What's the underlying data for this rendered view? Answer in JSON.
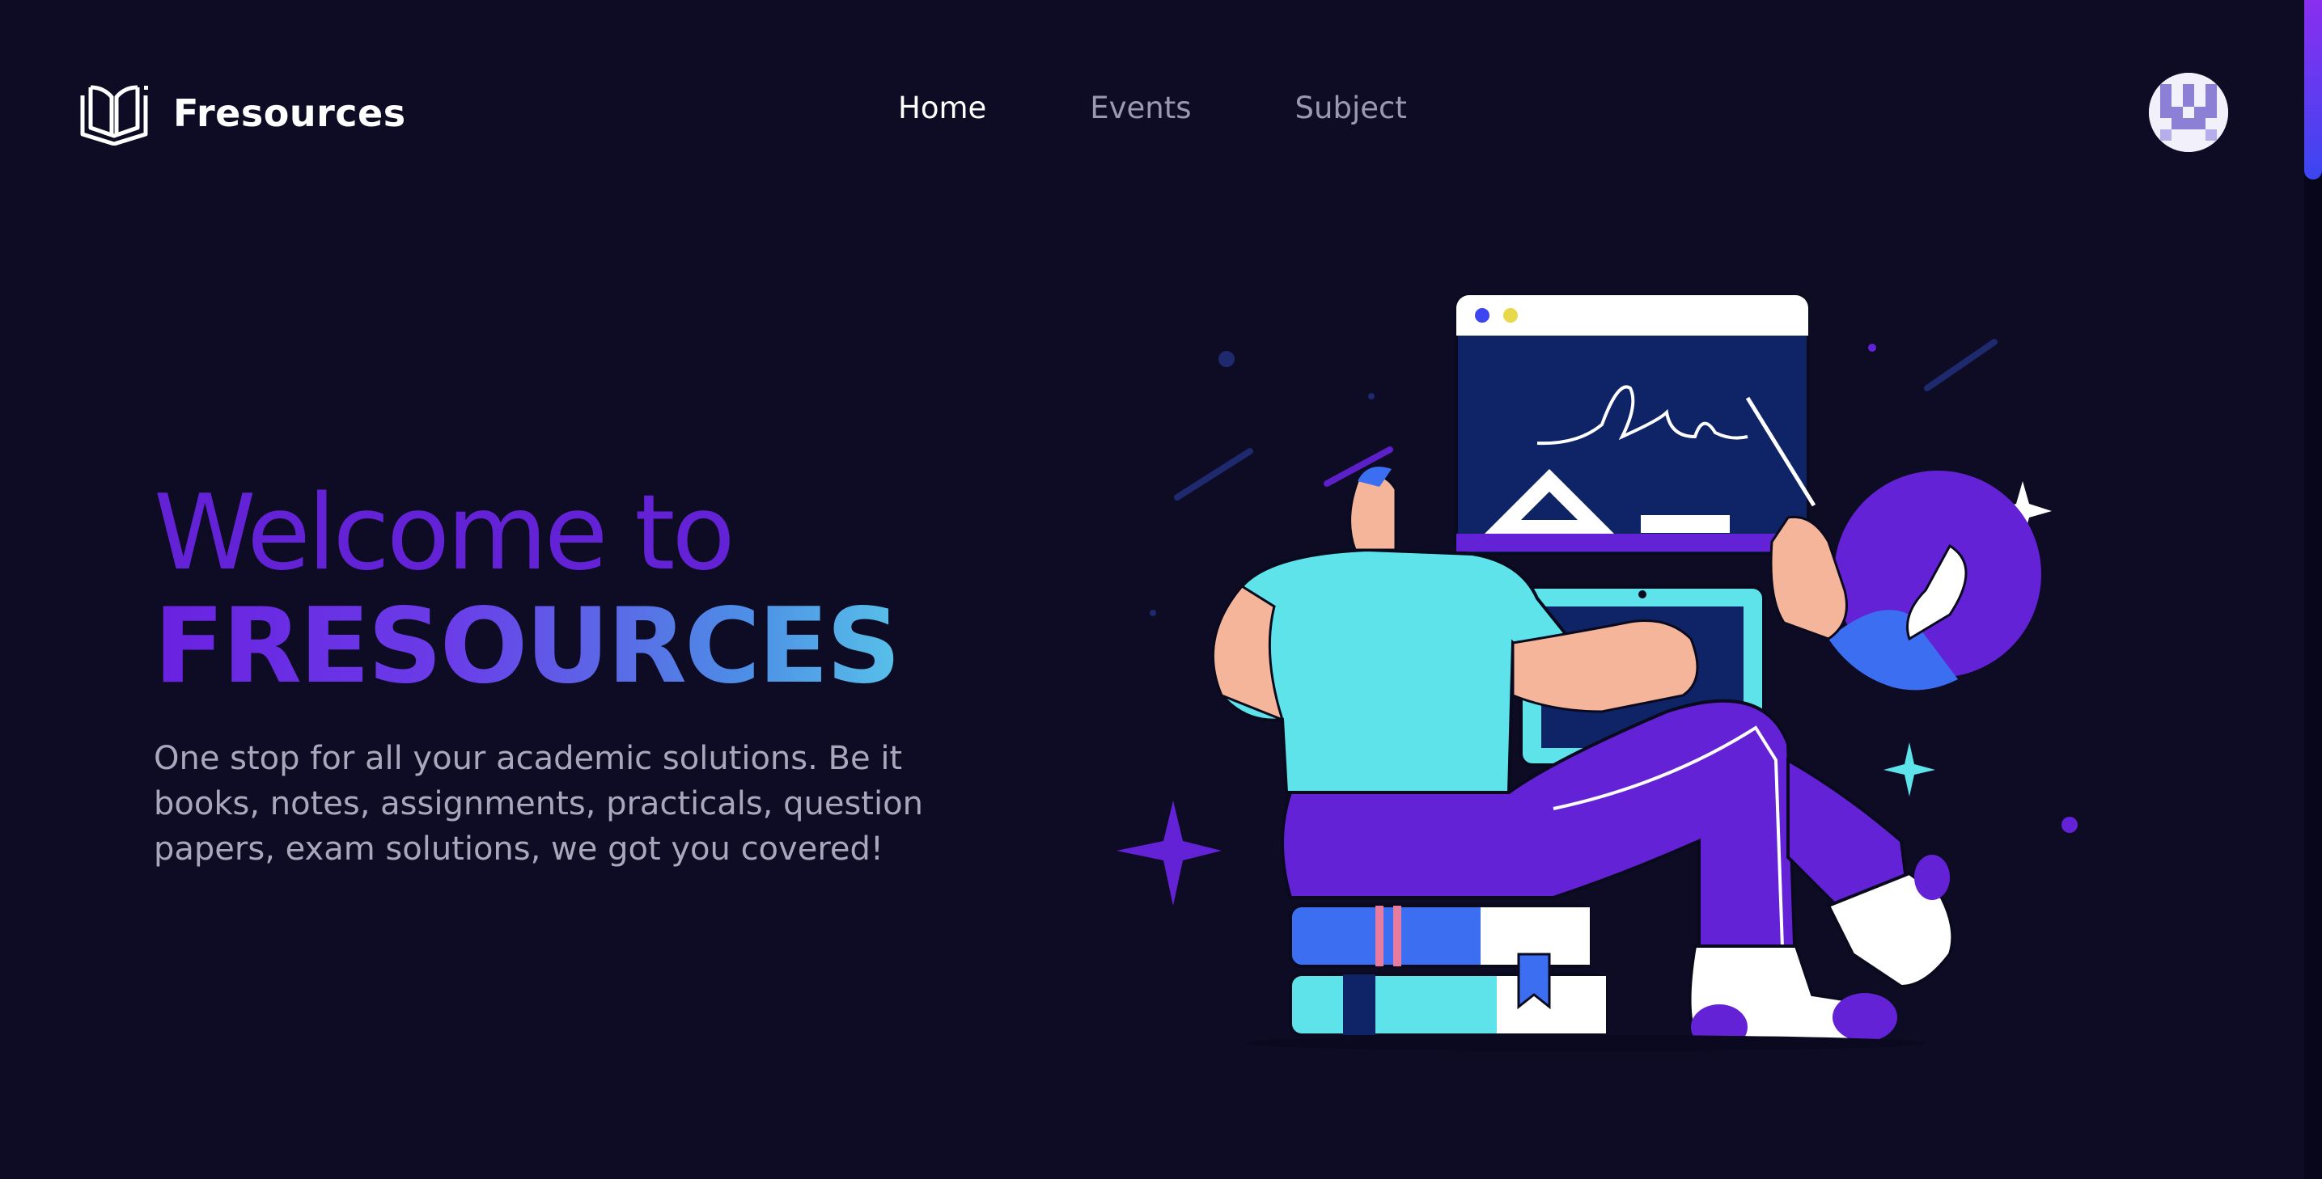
{
  "brand": {
    "name": "Fresources",
    "logo_icon": "open-book-icon"
  },
  "nav": {
    "items": [
      {
        "label": "Home",
        "active": true
      },
      {
        "label": "Events",
        "active": false
      },
      {
        "label": "Subject",
        "active": false
      }
    ]
  },
  "avatar": {
    "icon": "pixel-avatar-icon"
  },
  "hero": {
    "line1": "Welcome to",
    "line2": "FRESOURCES",
    "description": "One stop for all your academic solutions. Be it books, notes, assignments, practicals, question papers, exam solutions, we got you covered!"
  },
  "illustration": {
    "icon": "student-studying-illustration"
  },
  "colors": {
    "background": "#0e0c24",
    "accent_purple": "#6422d6",
    "accent_cyan": "#5fe3ea",
    "nav_muted": "#9b98b4",
    "text_muted": "#a9a6bd"
  }
}
